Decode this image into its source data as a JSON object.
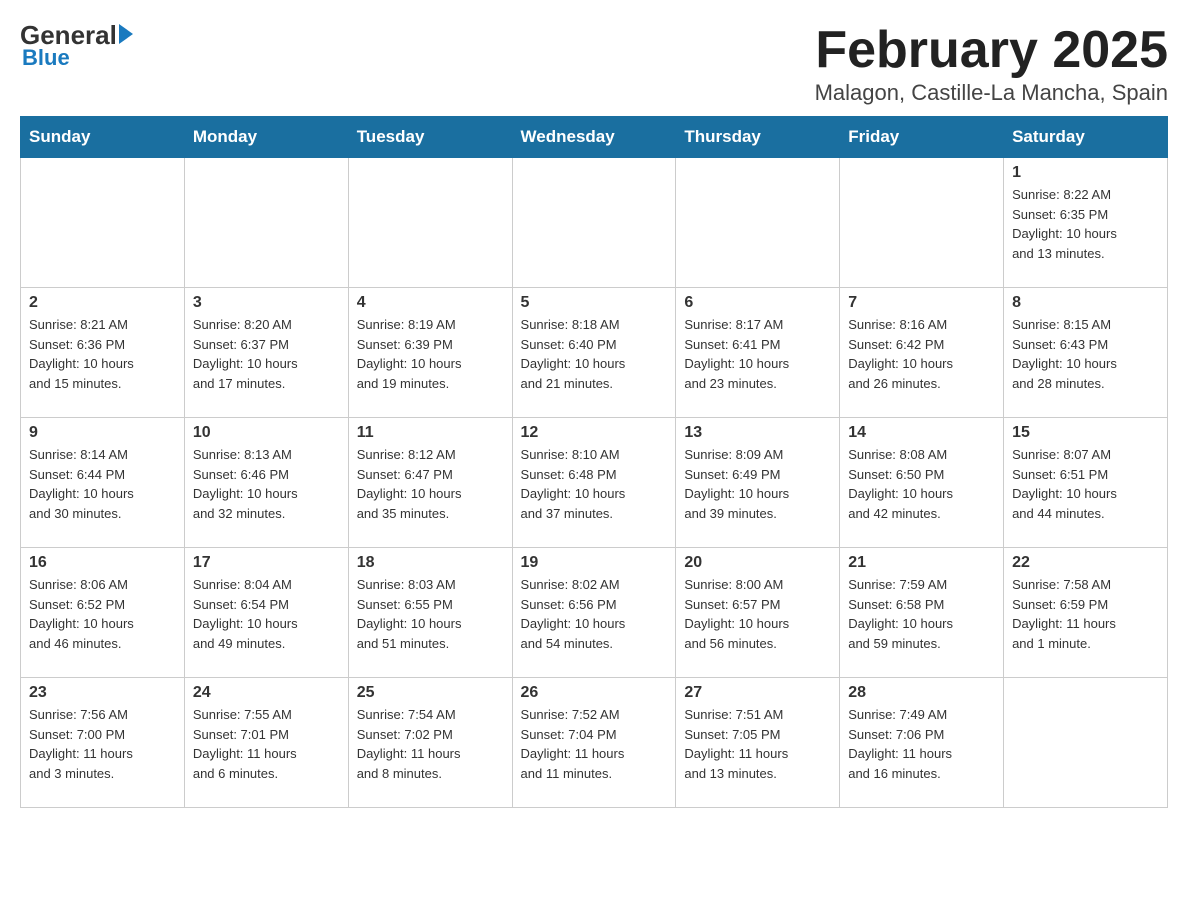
{
  "header": {
    "logo_general": "General",
    "logo_blue": "Blue",
    "title": "February 2025",
    "subtitle": "Malagon, Castille-La Mancha, Spain"
  },
  "days_of_week": [
    "Sunday",
    "Monday",
    "Tuesday",
    "Wednesday",
    "Thursday",
    "Friday",
    "Saturday"
  ],
  "weeks": [
    [
      {
        "day": "",
        "info": ""
      },
      {
        "day": "",
        "info": ""
      },
      {
        "day": "",
        "info": ""
      },
      {
        "day": "",
        "info": ""
      },
      {
        "day": "",
        "info": ""
      },
      {
        "day": "",
        "info": ""
      },
      {
        "day": "1",
        "info": "Sunrise: 8:22 AM\nSunset: 6:35 PM\nDaylight: 10 hours\nand 13 minutes."
      }
    ],
    [
      {
        "day": "2",
        "info": "Sunrise: 8:21 AM\nSunset: 6:36 PM\nDaylight: 10 hours\nand 15 minutes."
      },
      {
        "day": "3",
        "info": "Sunrise: 8:20 AM\nSunset: 6:37 PM\nDaylight: 10 hours\nand 17 minutes."
      },
      {
        "day": "4",
        "info": "Sunrise: 8:19 AM\nSunset: 6:39 PM\nDaylight: 10 hours\nand 19 minutes."
      },
      {
        "day": "5",
        "info": "Sunrise: 8:18 AM\nSunset: 6:40 PM\nDaylight: 10 hours\nand 21 minutes."
      },
      {
        "day": "6",
        "info": "Sunrise: 8:17 AM\nSunset: 6:41 PM\nDaylight: 10 hours\nand 23 minutes."
      },
      {
        "day": "7",
        "info": "Sunrise: 8:16 AM\nSunset: 6:42 PM\nDaylight: 10 hours\nand 26 minutes."
      },
      {
        "day": "8",
        "info": "Sunrise: 8:15 AM\nSunset: 6:43 PM\nDaylight: 10 hours\nand 28 minutes."
      }
    ],
    [
      {
        "day": "9",
        "info": "Sunrise: 8:14 AM\nSunset: 6:44 PM\nDaylight: 10 hours\nand 30 minutes."
      },
      {
        "day": "10",
        "info": "Sunrise: 8:13 AM\nSunset: 6:46 PM\nDaylight: 10 hours\nand 32 minutes."
      },
      {
        "day": "11",
        "info": "Sunrise: 8:12 AM\nSunset: 6:47 PM\nDaylight: 10 hours\nand 35 minutes."
      },
      {
        "day": "12",
        "info": "Sunrise: 8:10 AM\nSunset: 6:48 PM\nDaylight: 10 hours\nand 37 minutes."
      },
      {
        "day": "13",
        "info": "Sunrise: 8:09 AM\nSunset: 6:49 PM\nDaylight: 10 hours\nand 39 minutes."
      },
      {
        "day": "14",
        "info": "Sunrise: 8:08 AM\nSunset: 6:50 PM\nDaylight: 10 hours\nand 42 minutes."
      },
      {
        "day": "15",
        "info": "Sunrise: 8:07 AM\nSunset: 6:51 PM\nDaylight: 10 hours\nand 44 minutes."
      }
    ],
    [
      {
        "day": "16",
        "info": "Sunrise: 8:06 AM\nSunset: 6:52 PM\nDaylight: 10 hours\nand 46 minutes."
      },
      {
        "day": "17",
        "info": "Sunrise: 8:04 AM\nSunset: 6:54 PM\nDaylight: 10 hours\nand 49 minutes."
      },
      {
        "day": "18",
        "info": "Sunrise: 8:03 AM\nSunset: 6:55 PM\nDaylight: 10 hours\nand 51 minutes."
      },
      {
        "day": "19",
        "info": "Sunrise: 8:02 AM\nSunset: 6:56 PM\nDaylight: 10 hours\nand 54 minutes."
      },
      {
        "day": "20",
        "info": "Sunrise: 8:00 AM\nSunset: 6:57 PM\nDaylight: 10 hours\nand 56 minutes."
      },
      {
        "day": "21",
        "info": "Sunrise: 7:59 AM\nSunset: 6:58 PM\nDaylight: 10 hours\nand 59 minutes."
      },
      {
        "day": "22",
        "info": "Sunrise: 7:58 AM\nSunset: 6:59 PM\nDaylight: 11 hours\nand 1 minute."
      }
    ],
    [
      {
        "day": "23",
        "info": "Sunrise: 7:56 AM\nSunset: 7:00 PM\nDaylight: 11 hours\nand 3 minutes."
      },
      {
        "day": "24",
        "info": "Sunrise: 7:55 AM\nSunset: 7:01 PM\nDaylight: 11 hours\nand 6 minutes."
      },
      {
        "day": "25",
        "info": "Sunrise: 7:54 AM\nSunset: 7:02 PM\nDaylight: 11 hours\nand 8 minutes."
      },
      {
        "day": "26",
        "info": "Sunrise: 7:52 AM\nSunset: 7:04 PM\nDaylight: 11 hours\nand 11 minutes."
      },
      {
        "day": "27",
        "info": "Sunrise: 7:51 AM\nSunset: 7:05 PM\nDaylight: 11 hours\nand 13 minutes."
      },
      {
        "day": "28",
        "info": "Sunrise: 7:49 AM\nSunset: 7:06 PM\nDaylight: 11 hours\nand 16 minutes."
      },
      {
        "day": "",
        "info": ""
      }
    ]
  ]
}
